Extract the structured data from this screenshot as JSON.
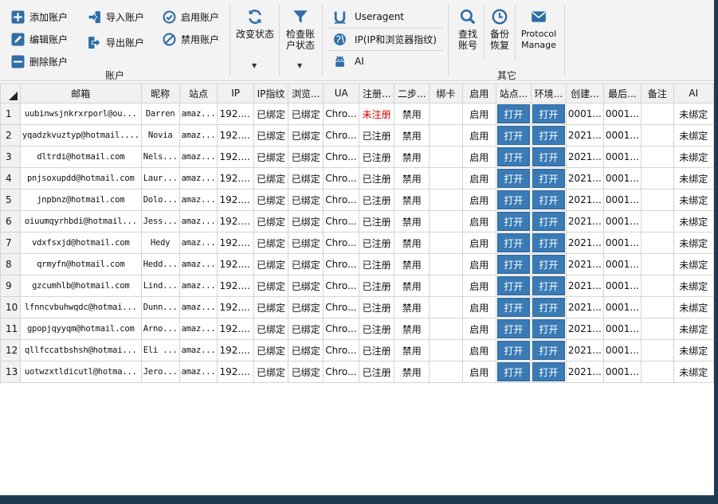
{
  "colors": {
    "accent": "#3a7bb5",
    "alert": "#e00000",
    "icon": "#2f6ea6"
  },
  "ribbon": {
    "account_group": {
      "label": "账户",
      "add": "添加账户",
      "edit": "编辑账户",
      "delete": "删除账户",
      "import": "导入账户",
      "export": "导出账户",
      "enable": "启用账户",
      "disable": "禁用账户",
      "change_status": "改变状态",
      "check_status_line1": "检查账",
      "check_status_line2": "户状态"
    },
    "fingerprint_group": {
      "useragent": "Useragent",
      "ip": "IP(IP和浏览器指纹)",
      "ai": "AI"
    },
    "other_group": {
      "label": "其它",
      "find_line1": "查找",
      "find_line2": "账号",
      "backup_line1": "备份",
      "backup_line2": "恢复",
      "protocol_line1": "Protocol",
      "protocol_line2": "Manage"
    }
  },
  "table": {
    "columns": [
      "邮箱",
      "昵称",
      "站点",
      "IP",
      "IP指纹",
      "浏览...",
      "UA",
      "注册...",
      "二步...",
      "绑卡",
      "启用",
      "站点...",
      "环境...",
      "创建...",
      "最后...",
      "备注",
      "AI"
    ],
    "open_label": "打开",
    "rows": [
      {
        "n": "1",
        "email": "uubinwsjnkrxrporl@ou...",
        "nick": "Darren",
        "site": "amaz...",
        "ip": "192....",
        "ipfp": "已绑定",
        "browser": "已绑定",
        "ua": "Chro...",
        "reg": "未注册",
        "twostep": "禁用",
        "card": "",
        "enabled": "启用",
        "created": "0001...",
        "last": "0001...",
        "note": "",
        "ai": "未绑定"
      },
      {
        "n": "2",
        "email": "yqadzkvuztyp@hotmail....",
        "nick": "Novia",
        "site": "amaz...",
        "ip": "192....",
        "ipfp": "已绑定",
        "browser": "已绑定",
        "ua": "Chro...",
        "reg": "已注册",
        "twostep": "禁用",
        "card": "",
        "enabled": "启用",
        "created": "2021...",
        "last": "0001...",
        "note": "",
        "ai": "未绑定"
      },
      {
        "n": "3",
        "email": "dltrdi@hotmail.com",
        "nick": "Nels...",
        "site": "amaz...",
        "ip": "192....",
        "ipfp": "已绑定",
        "browser": "已绑定",
        "ua": "Chro...",
        "reg": "已注册",
        "twostep": "禁用",
        "card": "",
        "enabled": "启用",
        "created": "2021...",
        "last": "0001...",
        "note": "",
        "ai": "未绑定"
      },
      {
        "n": "4",
        "email": "pnjsoxupdd@hotmail.com",
        "nick": "Laur...",
        "site": "amaz...",
        "ip": "192....",
        "ipfp": "已绑定",
        "browser": "已绑定",
        "ua": "Chro...",
        "reg": "已注册",
        "twostep": "禁用",
        "card": "",
        "enabled": "启用",
        "created": "2021...",
        "last": "0001...",
        "note": "",
        "ai": "未绑定"
      },
      {
        "n": "5",
        "email": "jnpbnz@hotmail.com",
        "nick": "Dolo...",
        "site": "amaz...",
        "ip": "192....",
        "ipfp": "已绑定",
        "browser": "已绑定",
        "ua": "Chro...",
        "reg": "已注册",
        "twostep": "禁用",
        "card": "",
        "enabled": "启用",
        "created": "2021...",
        "last": "0001...",
        "note": "",
        "ai": "未绑定"
      },
      {
        "n": "6",
        "email": "oiuumqyrhbdi@hotmail...",
        "nick": "Jess...",
        "site": "amaz...",
        "ip": "192....",
        "ipfp": "已绑定",
        "browser": "已绑定",
        "ua": "Chro...",
        "reg": "已注册",
        "twostep": "禁用",
        "card": "",
        "enabled": "启用",
        "created": "2021...",
        "last": "0001...",
        "note": "",
        "ai": "未绑定"
      },
      {
        "n": "7",
        "email": "vdxfsxjd@hotmail.com",
        "nick": "Hedy",
        "site": "amaz...",
        "ip": "192....",
        "ipfp": "已绑定",
        "browser": "已绑定",
        "ua": "Chro...",
        "reg": "已注册",
        "twostep": "禁用",
        "card": "",
        "enabled": "启用",
        "created": "2021...",
        "last": "0001...",
        "note": "",
        "ai": "未绑定"
      },
      {
        "n": "8",
        "email": "qrmyfn@hotmail.com",
        "nick": "Hedd...",
        "site": "amaz...",
        "ip": "192....",
        "ipfp": "已绑定",
        "browser": "已绑定",
        "ua": "Chro...",
        "reg": "已注册",
        "twostep": "禁用",
        "card": "",
        "enabled": "启用",
        "created": "2021...",
        "last": "0001...",
        "note": "",
        "ai": "未绑定"
      },
      {
        "n": "9",
        "email": "gzcumhlb@hotmail.com",
        "nick": "Lind...",
        "site": "amaz...",
        "ip": "192....",
        "ipfp": "已绑定",
        "browser": "已绑定",
        "ua": "Chro...",
        "reg": "已注册",
        "twostep": "禁用",
        "card": "",
        "enabled": "启用",
        "created": "2021...",
        "last": "0001...",
        "note": "",
        "ai": "未绑定"
      },
      {
        "n": "10",
        "email": "lfnncvbuhwqdc@hotmai...",
        "nick": "Dunn...",
        "site": "amaz...",
        "ip": "192....",
        "ipfp": "已绑定",
        "browser": "已绑定",
        "ua": "Chro...",
        "reg": "已注册",
        "twostep": "禁用",
        "card": "",
        "enabled": "启用",
        "created": "2021...",
        "last": "0001...",
        "note": "",
        "ai": "未绑定"
      },
      {
        "n": "11",
        "email": "gpopjqyyqm@hotmail.com",
        "nick": "Arno...",
        "site": "amaz...",
        "ip": "192....",
        "ipfp": "已绑定",
        "browser": "已绑定",
        "ua": "Chro...",
        "reg": "已注册",
        "twostep": "禁用",
        "card": "",
        "enabled": "启用",
        "created": "2021...",
        "last": "0001...",
        "note": "",
        "ai": "未绑定"
      },
      {
        "n": "12",
        "email": "qllfccatbshsh@hotmai...",
        "nick": "Eli ...",
        "site": "amaz...",
        "ip": "192....",
        "ipfp": "已绑定",
        "browser": "已绑定",
        "ua": "Chro...",
        "reg": "已注册",
        "twostep": "禁用",
        "card": "",
        "enabled": "启用",
        "created": "2021...",
        "last": "0001...",
        "note": "",
        "ai": "未绑定"
      },
      {
        "n": "13",
        "email": "uotwzxtldicutl@hotma...",
        "nick": "Jero...",
        "site": "amaz...",
        "ip": "192....",
        "ipfp": "已绑定",
        "browser": "已绑定",
        "ua": "Chro...",
        "reg": "已注册",
        "twostep": "禁用",
        "card": "",
        "enabled": "启用",
        "created": "2021...",
        "last": "0001...",
        "note": "",
        "ai": "未绑定"
      }
    ]
  }
}
